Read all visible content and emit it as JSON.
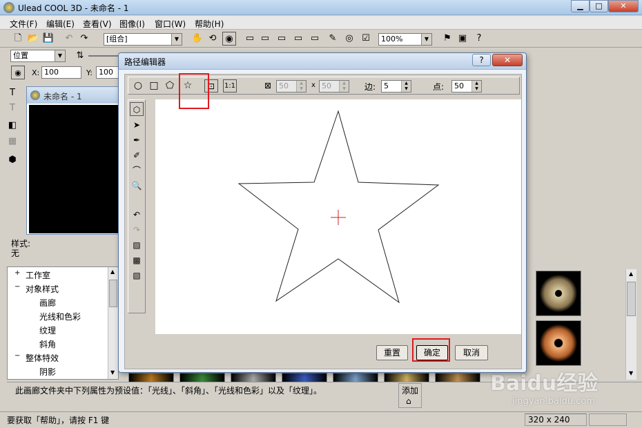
{
  "app": {
    "title": "Ulead COOL 3D - 未命名 - 1"
  },
  "menu": [
    "文件(F)",
    "编辑(E)",
    "查看(V)",
    "图像(I)",
    "窗口(W)",
    "帮助(H)"
  ],
  "toolbar": {
    "group_combo": "[组合]",
    "zoom_combo": "100%"
  },
  "toolbar2": {
    "position_combo": "位置"
  },
  "toolbar3": {
    "x_label": "X:",
    "x_value": "100",
    "y_label": "Y:",
    "y_value": "100"
  },
  "document": {
    "title": "未命名 - 1"
  },
  "style_panel": {
    "label": "样式:",
    "value": "无"
  },
  "tree": [
    {
      "label": "工作室",
      "expander": "+",
      "level": 0
    },
    {
      "label": "对象样式",
      "expander": "−",
      "level": 0
    },
    {
      "label": "画廊",
      "level": 1
    },
    {
      "label": "光线和色彩",
      "level": 1
    },
    {
      "label": "纹理",
      "level": 1
    },
    {
      "label": "斜角",
      "level": 1
    },
    {
      "label": "整体特效",
      "expander": "−",
      "level": 0
    },
    {
      "label": "阴影",
      "level": 1
    }
  ],
  "description": "此画廊文件夹中下列属性为预设值：「光线」、「斜角」、「光线和色彩」以及「纹理」。",
  "add_label": "添加",
  "status": {
    "help": "要获取「帮助」，请按 F1 键",
    "size": "320 x 240"
  },
  "dialog": {
    "title": "路径编辑器",
    "help_btn": "?",
    "close_btn": "✕",
    "width_value": "50",
    "height_value": "50",
    "times": "x",
    "sides_label": "边:",
    "sides_value": "5",
    "points_label": "点:",
    "points_value": "50",
    "buttons": {
      "reset": "重置",
      "ok": "确定",
      "cancel": "取消"
    }
  },
  "watermark": {
    "brand": "Baidu经验",
    "url": "jingyan.baidu.com"
  },
  "colors": {
    "highlight": "#e0191f",
    "crosshair": "#cc2222"
  }
}
